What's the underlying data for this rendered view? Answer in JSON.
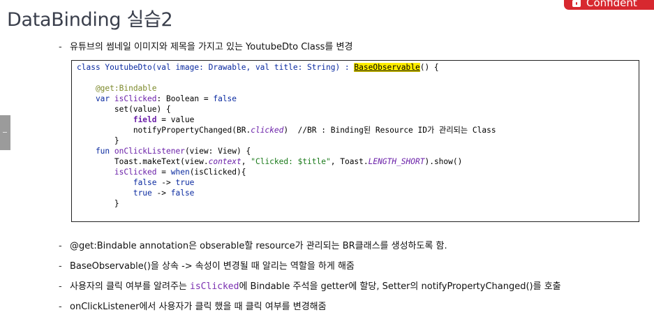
{
  "slide": {
    "title": "DataBinding 실습2",
    "badge": "Confident"
  },
  "intro": {
    "dash": "-",
    "text": "유튜브의 썸네일 이미지와 제목을 가지고 있는 YoutubeDto Class를 변경"
  },
  "code": {
    "l1_a": "class YoutubeDto(val image: Drawable, val title: String) : ",
    "l1_hl": "BaseObservable",
    "l1_b": "() {",
    "l2": "",
    "l3": "    @get:Bindable",
    "l4_a": "    var ",
    "l4_b": "isClicked",
    "l4_c": ": Boolean = ",
    "l4_d": "false",
    "l5": "        set(value) {",
    "l6_a": "            ",
    "l6_b": "field",
    "l6_c": " = value",
    "l7_a": "            notifyPropertyChanged(BR.",
    "l7_b": "clicked",
    "l7_c": ")  //BR : Binding된 Resource ID가 관리되는 Class",
    "l8": "        }",
    "l9_a": "    fun ",
    "l9_b": "onClickListener",
    "l9_c": "(view: View) {",
    "l10_a": "        Toast.makeText(view.",
    "l10_b": "context",
    "l10_c": ", ",
    "l10_d": "\"Clicked: $title\"",
    "l10_e": ", Toast.",
    "l10_f": "LENGTH_SHORT",
    "l10_g": ").show()",
    "l11_a": "        ",
    "l11_b": "isClicked",
    "l11_c": " = ",
    "l11_d": "when",
    "l11_e": "(isClicked){",
    "l12_a": "            ",
    "l12_b": "false",
    "l12_c": " -> ",
    "l12_d": "true",
    "l13_a": "            ",
    "l13_b": "true",
    "l13_c": " -> ",
    "l13_d": "false",
    "l14": "        }"
  },
  "notes": [
    {
      "dash": "-",
      "text": "@get:Bindable annotation은  obserable할 resource가 관리되는 BR클래스를 생성하도록 함."
    },
    {
      "dash": "-",
      "text": "BaseObservable()을 상속 -> 속성이 변경될 때 알리는 역할을 하게 해줌"
    },
    {
      "dash": "-",
      "pre": "사용자의 클릭 여부를 알려주는 ",
      "code": "isClicked",
      "post": "에 Bindable 주석을 getter에 할당, Setter의 notifyPropertyChanged()를 호출"
    },
    {
      "dash": "-",
      "text": "onClickListener에서 사용자가 클릭 했을 때 클릭 여부를 변경해줌"
    }
  ]
}
